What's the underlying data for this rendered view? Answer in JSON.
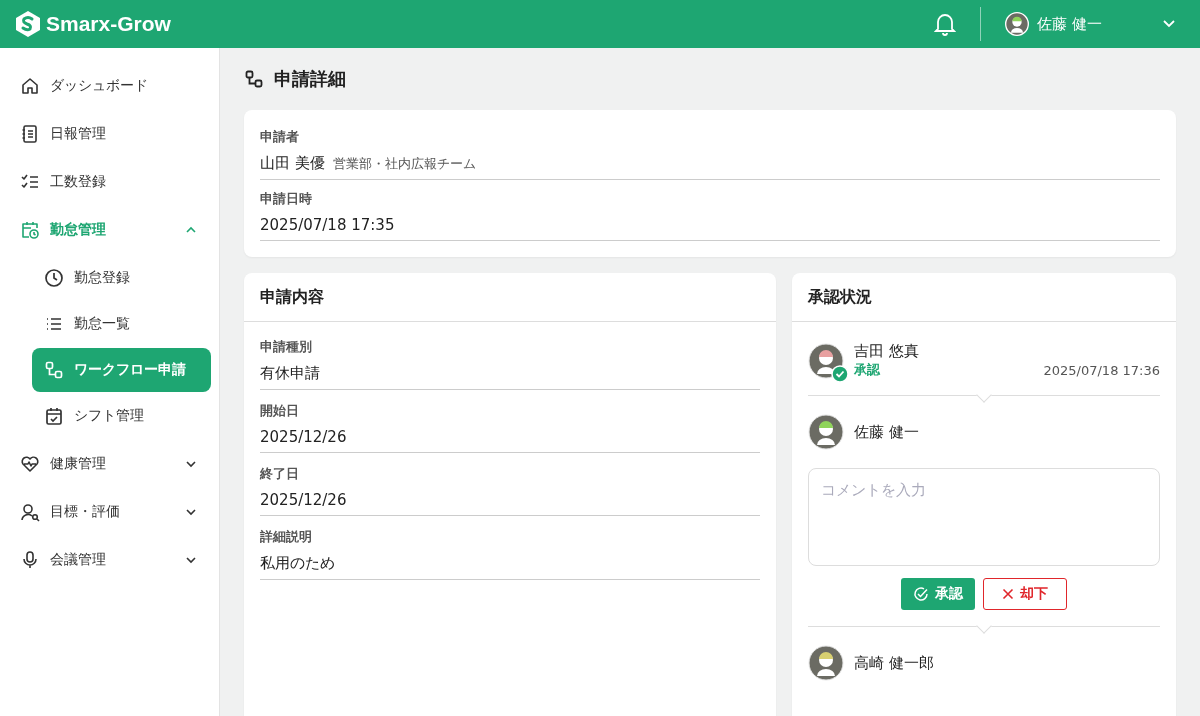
{
  "header": {
    "logo": "Smarx-Grow",
    "user": "佐藤 健一"
  },
  "sidebar": {
    "items": [
      {
        "label": "ダッシュボード"
      },
      {
        "label": "日報管理"
      },
      {
        "label": "工数登録"
      },
      {
        "label": "勤怠管理",
        "expanded": true,
        "children": [
          {
            "label": "勤怠登録",
            "selected": false
          },
          {
            "label": "勤怠一覧",
            "selected": false
          },
          {
            "label": "ワークフロー申請",
            "selected": true
          },
          {
            "label": "シフト管理",
            "selected": false
          }
        ]
      },
      {
        "label": "健康管理",
        "expanded": false
      },
      {
        "label": "目標・評価",
        "expanded": false
      },
      {
        "label": "会議管理",
        "expanded": false
      }
    ]
  },
  "page_title": "申請詳細",
  "applicant": {
    "label": "申請者",
    "name": "山田 美優",
    "department": "営業部・社内広報チーム",
    "date_label": "申請日時",
    "date": "2025/07/18 17:35"
  },
  "request": {
    "title": "申請内容",
    "fields": [
      {
        "label": "申請種別",
        "value": "有休申請"
      },
      {
        "label": "開始日",
        "value": "2025/12/26"
      },
      {
        "label": "終了日",
        "value": "2025/12/26"
      },
      {
        "label": "詳細説明",
        "value": "私用のため"
      }
    ]
  },
  "approval": {
    "title": "承認状況",
    "approvers": [
      {
        "kind": "approved",
        "name": "吉田 悠真",
        "color": "#e8a0a0",
        "status": "承認",
        "time": "2025/07/18 17:36"
      },
      {
        "kind": "current",
        "name": "佐藤 健一",
        "color": "#8fd45a",
        "comment_placeholder": "コメントを入力",
        "approve": "承認",
        "reject": "却下"
      },
      {
        "kind": "pending",
        "name": "高崎 健一郎",
        "color": "#d8d070"
      }
    ]
  }
}
